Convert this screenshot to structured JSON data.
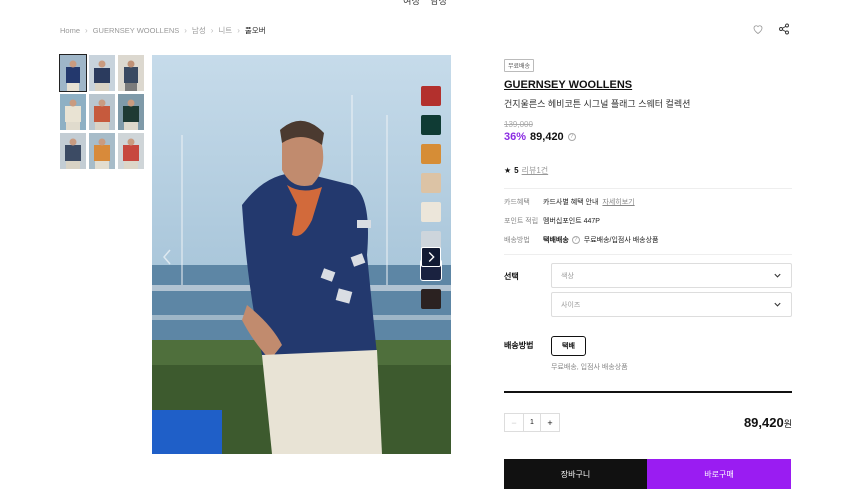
{
  "topnav": [
    "여성",
    "남성"
  ],
  "breadcrumb": [
    "Home",
    "GUERNSEY WOOLLENS",
    "남성",
    "니트",
    "풀오버"
  ],
  "badge": "무료배송",
  "brand": "GUERNSEY WOOLLENS",
  "product_name": "건지울른스 헤비코튼 시그널 플래그 스웨터 컬렉션",
  "original_price": "139,000",
  "discount": "36%",
  "price": "89,420",
  "rating": {
    "score": "5",
    "reviews": "리뷰1건"
  },
  "info": {
    "card_label": "카드혜택",
    "card_value": "카드사별 혜택 안내",
    "card_link": "자세히보기",
    "point_label": "포인트 적립",
    "point_value": "멤버십포인트 447P",
    "ship_label": "배송방법",
    "ship_value_bold": "택배배송",
    "ship_value": "무료배송/입점사 배송상품"
  },
  "options": {
    "label": "선택",
    "color_placeholder": "색상",
    "size_placeholder": "사이즈"
  },
  "shipping": {
    "label": "배송방법",
    "button": "택배",
    "note": "무료배송, 입점사 배송상품"
  },
  "quantity": {
    "minus": "−",
    "value": "1",
    "plus": "+"
  },
  "total": {
    "amount": "89,420",
    "unit": "원"
  },
  "buttons": {
    "cart": "장바구니",
    "buy": "바로구매"
  },
  "swatch_colors": [
    "#b3302d",
    "#0f3b34",
    "#d68d36",
    "#dcc3a5",
    "#ece6da",
    "#cdd5dc",
    "#1a2240",
    "#2b2221"
  ],
  "accent": "#9a1cf2"
}
